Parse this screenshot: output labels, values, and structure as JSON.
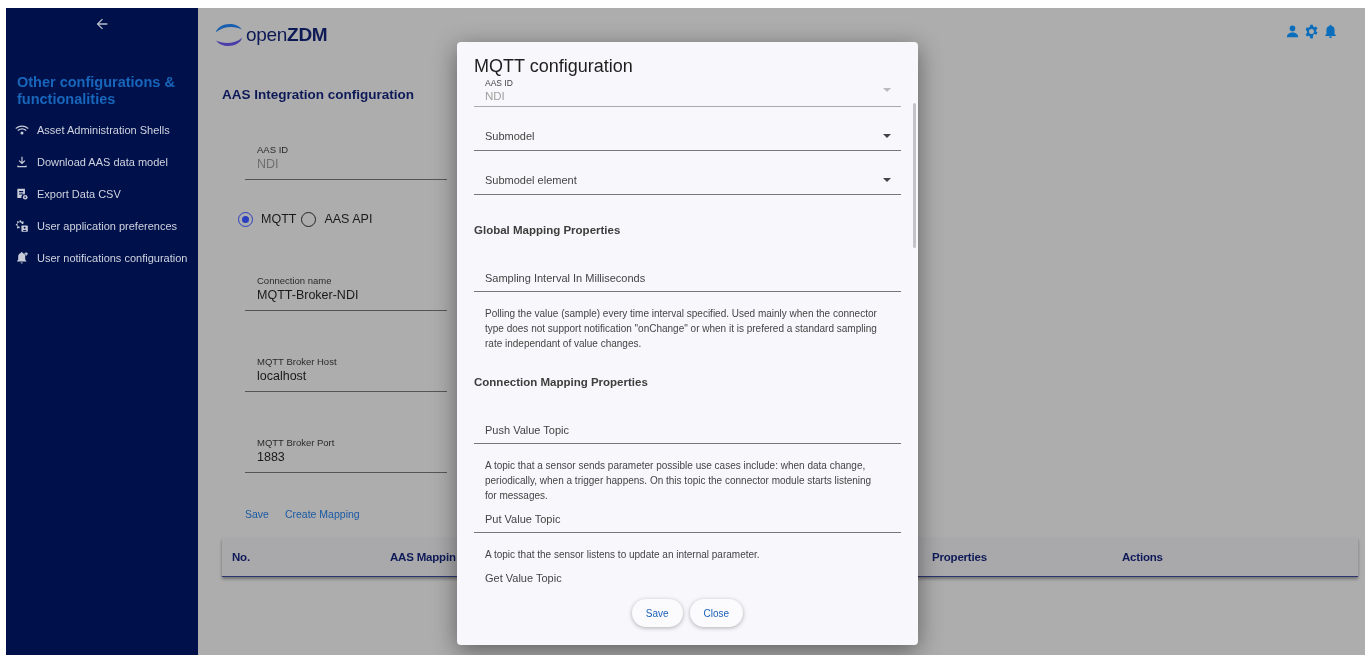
{
  "sidebar": {
    "title": "Other configurations & functionalities",
    "items": [
      {
        "label": "Asset Administration Shells"
      },
      {
        "label": "Download AAS data model"
      },
      {
        "label": "Export Data CSV"
      },
      {
        "label": "User application preferences"
      },
      {
        "label": "User notifications configuration"
      }
    ]
  },
  "header": {
    "logo": "open**ZDM**"
  },
  "page": {
    "title": "AAS Integration configuration",
    "aas_field": {
      "label": "AAS ID",
      "value": "NDI",
      "disabled": true
    },
    "protocol_options": [
      {
        "label": "MQTT",
        "selected": true
      },
      {
        "label": "AAS API",
        "selected": false
      }
    ],
    "fields": [
      {
        "label": "Connection name",
        "value": "MQTT-Broker-NDI"
      },
      {
        "label": "MQTT Broker Host",
        "value": "localhost"
      },
      {
        "label": "MQTT Broker Port",
        "value": "1883"
      }
    ],
    "actions": [
      "Save",
      "Create Mapping"
    ],
    "table": {
      "columns": [
        "No.",
        "AAS Mappin",
        "Properties",
        "Actions"
      ]
    }
  },
  "dialog": {
    "title": "MQTT configuration",
    "content": [
      {
        "kind": "select",
        "label": "AAS ID",
        "value": "NDI",
        "disabled": true
      },
      {
        "kind": "select",
        "label": "Submodel",
        "disabled": false
      },
      {
        "kind": "select",
        "label": "Submodel element",
        "disabled": false
      },
      {
        "kind": "heading",
        "text": "Global Mapping Properties"
      },
      {
        "kind": "field",
        "label": "Sampling Interval In Milliseconds"
      },
      {
        "kind": "hint",
        "text": "Polling the value (sample) every time interval specified. Used mainly when the connector type does not support notification \"onChange\" or when it is prefered a standard sampling rate independant of value changes."
      },
      {
        "kind": "heading",
        "text": "Connection Mapping Properties"
      },
      {
        "kind": "field",
        "label": "Push Value Topic"
      },
      {
        "kind": "hint",
        "text": "A topic that a sensor sends parameter possible use cases include: when data change, periodically, when a trigger happens. On this topic the connector module starts listening for messages."
      },
      {
        "kind": "field",
        "label": "Put Value Topic"
      },
      {
        "kind": "hint",
        "text": "A topic that the sensor listens to update an internal parameter."
      },
      {
        "kind": "field",
        "label": "Get Value Topic"
      }
    ],
    "buttons": [
      "Save",
      "Close"
    ]
  }
}
